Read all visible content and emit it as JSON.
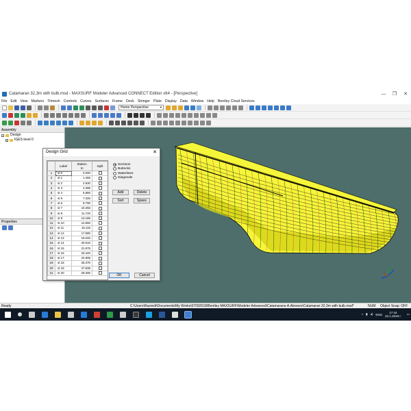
{
  "window": {
    "title": "Catamaran 32,3m with bulb.msd - MAXSURF Modeler Advanced CONNECT Edition x64 - [Perspective]",
    "controls": [
      "—",
      "❐",
      "✕"
    ]
  },
  "menu": [
    "File",
    "Edit",
    "View",
    "Markers",
    "Trimesh",
    "Controls",
    "Curves",
    "Surfaces",
    "Frame",
    "Deck",
    "Stringer",
    "Plate",
    "Display",
    "Data",
    "Window",
    "Help",
    "Bentley Cloud Services"
  ],
  "toolbar": {
    "view_select": "Home Perspective"
  },
  "assembly": {
    "title": "Assembly",
    "items": [
      {
        "label": "Design",
        "expander": "−"
      },
      {
        "label": "IGES level 0",
        "expander": "+"
      }
    ]
  },
  "properties": {
    "title": "Properties"
  },
  "dialog": {
    "title": "Design Grid",
    "columns": {
      "label": "Label",
      "station": "Station",
      "unit": "m",
      "split": "Split"
    },
    "rows": [
      {
        "n": "1",
        "label": "st 0",
        "station": "0.000"
      },
      {
        "n": "2",
        "label": "st 1",
        "station": "1.465"
      },
      {
        "n": "3",
        "label": "st 2",
        "station": "2.930"
      },
      {
        "n": "4",
        "label": "st 3",
        "station": "4.395"
      },
      {
        "n": "5",
        "label": "st 4",
        "station": "5.860"
      },
      {
        "n": "6",
        "label": "st 5",
        "station": "7.325"
      },
      {
        "n": "7",
        "label": "st 6",
        "station": "8.790"
      },
      {
        "n": "8",
        "label": "st 7",
        "station": "10.255"
      },
      {
        "n": "9",
        "label": "st 8",
        "station": "11.720"
      },
      {
        "n": "10",
        "label": "st 9",
        "station": "13.185"
      },
      {
        "n": "11",
        "label": "st 10",
        "station": "14.650"
      },
      {
        "n": "12",
        "label": "st 11",
        "station": "16.115"
      },
      {
        "n": "13",
        "label": "st 12",
        "station": "17.580"
      },
      {
        "n": "14",
        "label": "st 13",
        "station": "19.045"
      },
      {
        "n": "15",
        "label": "st 14",
        "station": "20.510"
      },
      {
        "n": "16",
        "label": "st 15",
        "station": "21.975"
      },
      {
        "n": "17",
        "label": "st 16",
        "station": "23.440"
      },
      {
        "n": "18",
        "label": "st 17",
        "station": "24.905"
      },
      {
        "n": "19",
        "label": "st 18",
        "station": "26.370"
      },
      {
        "n": "20",
        "label": "st 19",
        "station": "27.835"
      },
      {
        "n": "21",
        "label": "st 20",
        "station": "29.300"
      }
    ],
    "grid_types": [
      "Sections",
      "Buttocks",
      "Waterlines",
      "Diagonals"
    ],
    "selected_grid_type": "Sections",
    "buttons": {
      "add": "Add",
      "delete": "Delete",
      "sort": "Sort",
      "space": "Space",
      "ok": "OK",
      "cancel": "Cancel"
    }
  },
  "status": {
    "ready": "Ready",
    "path": "C:\\Users\\Razredi\\Documents\\My Works\\07092018\\Bentley MAXSURF\\Modeler Advanced\\Catamarans-A.Alexeev\\Catamaran 32,3m with bulb.msd*",
    "num": "NUM",
    "snap": "Object Snap: OFF"
  },
  "taskbar": {
    "lang": "ENG",
    "time": "17:44",
    "date": "22.1.2018 г."
  },
  "colors": {
    "viewport_bg": "#4d6e6b",
    "hull": "#f5f53a",
    "hull_shade": "#cfcf12",
    "gridline": "#000000",
    "sectionline": "#c03030",
    "taskbar": "#0f1a26"
  }
}
